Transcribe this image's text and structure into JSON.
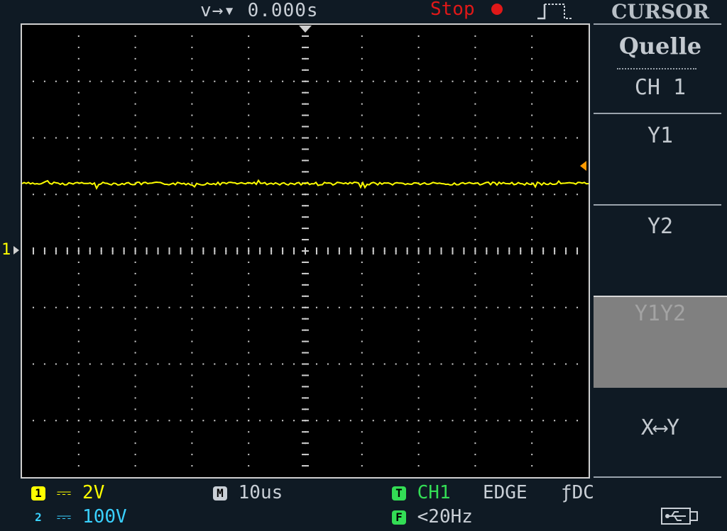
{
  "top": {
    "trigger_time": "v→▾ 0.000s",
    "run_state": "Stop"
  },
  "screen": {
    "ch1_marker": "1",
    "grid": {
      "h_divisions": 10,
      "v_divisions": 8
    }
  },
  "menu": {
    "title": "CURSOR",
    "source_label": "Quelle",
    "source_value": "CH 1",
    "items": [
      "Y1",
      "Y2",
      "Y1Y2",
      "X⟷Y"
    ],
    "selected_index": 2
  },
  "status": {
    "ch1_num": "1",
    "ch1_coupling": "⎓ 2V",
    "ch2_num": "2",
    "ch2_coupling": "⎓ 100V",
    "timebase_badge": "M",
    "timebase": "10us",
    "trig_badge": "T",
    "trig_source": "CH1",
    "trig_type": "EDGE",
    "trig_slope": "ƒDC",
    "freq_badge": "F",
    "freq": "<20Hz"
  },
  "colors": {
    "ch1": "#ffff00",
    "ch2": "#3ad1ff",
    "trigger": "#33dd55",
    "stop": "#e01818",
    "grid": "#cfcfcf"
  },
  "icons": [
    "trigger-edge-icon",
    "stop-indicator-icon",
    "usb-icon"
  ]
}
